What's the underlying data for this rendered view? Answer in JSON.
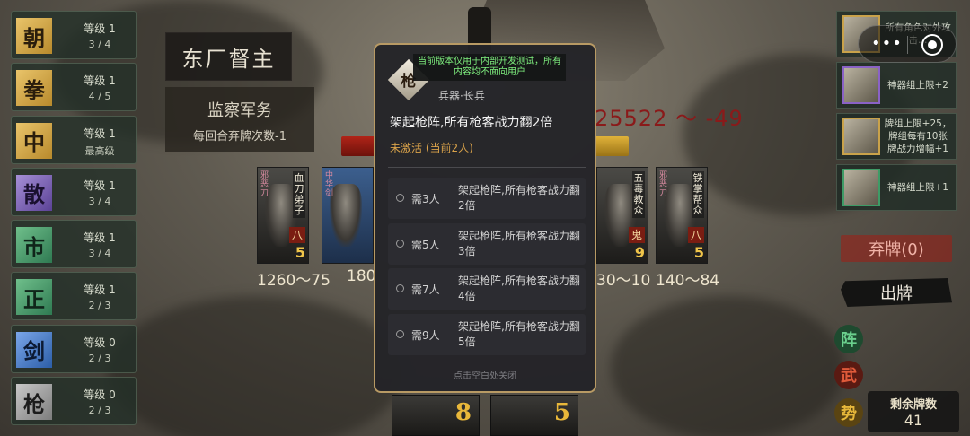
{
  "factions": [
    {
      "glyph": "朝",
      "level": "等级 1",
      "count": "3 / 4",
      "color": "gold"
    },
    {
      "glyph": "拳",
      "level": "等级 1",
      "count": "4 / 5",
      "color": "gold-diamond"
    },
    {
      "glyph": "中",
      "level": "等级 1",
      "count": "最高级",
      "color": "gold"
    },
    {
      "glyph": "散",
      "level": "等级 1",
      "count": "3 / 4",
      "color": "purple"
    },
    {
      "glyph": "市",
      "level": "等级 1",
      "count": "3 / 4",
      "color": "green"
    },
    {
      "glyph": "正",
      "level": "等级 1",
      "count": "2 / 3",
      "color": "green"
    },
    {
      "glyph": "剑",
      "level": "等级 0",
      "count": "2 / 3",
      "color": "blue"
    },
    {
      "glyph": "枪",
      "level": "等级 0",
      "count": "2 / 3",
      "color": "gray"
    }
  ],
  "boss": {
    "name": "东厂督主",
    "skill_title": "监察军务",
    "skill_desc": "每回合弃牌次数-1"
  },
  "score_range": "25522 ～ -49",
  "table_cards": [
    {
      "name": "血刀弟子",
      "tag": "邪恶刀",
      "badge": "八",
      "power": "5",
      "range": "1260～75"
    },
    {
      "name": "",
      "tag": "中华剑",
      "badge": "",
      "power": "",
      "range": "180"
    },
    {
      "name": "五毒教众",
      "tag": "",
      "badge": "鬼",
      "power": "9",
      "range": "30～10"
    },
    {
      "name": "铁掌帮众",
      "tag": "邪恶刀",
      "badge": "八",
      "power": "5",
      "range": "140～84"
    }
  ],
  "hand_cards": [
    {
      "power": "8"
    },
    {
      "power": "5"
    }
  ],
  "right_panel": [
    {
      "text": "所有角色对外攻击…",
      "frame": "gold"
    },
    {
      "text": "神器组上限+2",
      "frame": "purple"
    },
    {
      "text": "牌组上限+25，牌组每有10张牌战力增幅+1",
      "frame": "gold"
    },
    {
      "text": "神器组上限+1",
      "frame": "green"
    }
  ],
  "capsule": {
    "more": "•••"
  },
  "discard_label": "弃牌(0)",
  "play_label": "出牌",
  "side_glyphs": [
    "阵",
    "武",
    "势"
  ],
  "deck": {
    "label": "剩余牌数",
    "count": "41"
  },
  "modal": {
    "weapon_glyph": "枪",
    "notice": "当前版本仅用于内部开发测试，所有内容均不面向用户",
    "weapon_type": "兵器·长兵",
    "effect": "架起枪阵,所有枪客战力翻2倍",
    "status": "未激活 (当前2人)",
    "tiers": [
      {
        "need": "需3人",
        "desc": "架起枪阵,所有枪客战力翻2倍"
      },
      {
        "need": "需5人",
        "desc": "架起枪阵,所有枪客战力翻3倍"
      },
      {
        "need": "需7人",
        "desc": "架起枪阵,所有枪客战力翻4倍"
      },
      {
        "need": "需9人",
        "desc": "架起枪阵,所有枪客战力翻5倍"
      }
    ],
    "close_hint": "点击空白处关闭"
  },
  "colors": {
    "modal_border": "#b89a64",
    "notice_text": "#7ff07f",
    "status_text": "#d9a24a",
    "score_text": "#8a1a1a"
  }
}
